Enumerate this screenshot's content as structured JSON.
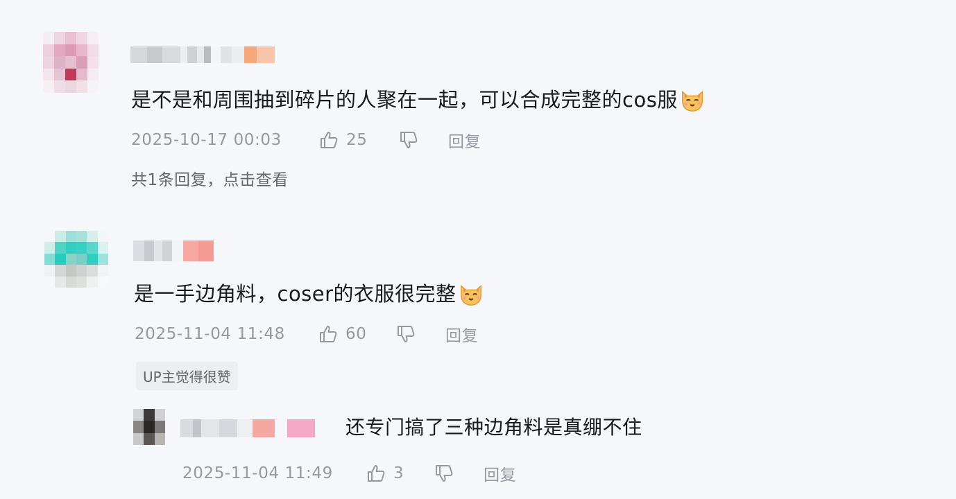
{
  "comments": [
    {
      "text": "是不是和周围抽到碎片的人聚在一起，可以合成完整的cos服",
      "emoji": "cat-emoji",
      "date": "2025-10-17 00:03",
      "likes": "25",
      "reply_label": "回复",
      "view_replies": "共1条回复，点击查看"
    },
    {
      "text": "是一手边角料，coser的衣服很完整",
      "emoji": "cat-emoji",
      "date": "2025-11-04 11:48",
      "likes": "60",
      "reply_label": "回复",
      "badge": "UP主觉得很赞",
      "replies": [
        {
          "text": "还专门搞了三种边角料是真绷不住",
          "date": "2025-11-04 11:49",
          "likes": "3",
          "reply_label": "回复"
        }
      ]
    }
  ],
  "colors": {
    "background": "#f6f7fb",
    "text": "#18191c",
    "meta": "#9499a0"
  }
}
